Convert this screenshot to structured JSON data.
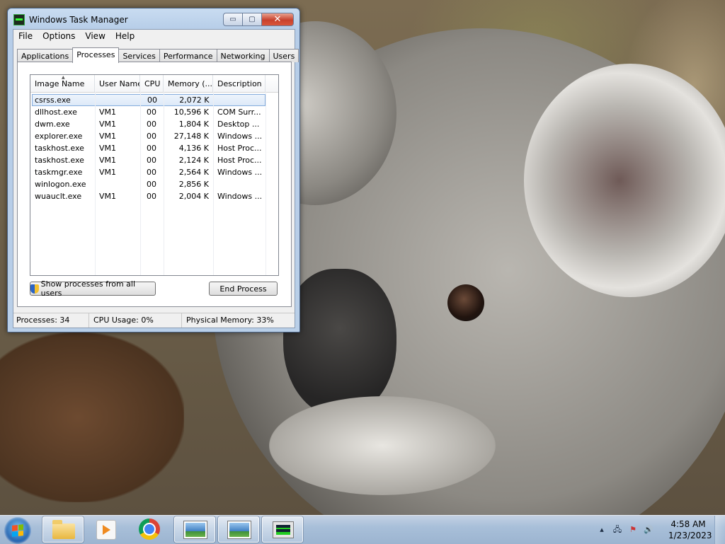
{
  "window": {
    "title": "Windows Task Manager",
    "buttons": {
      "minimize": "▭",
      "maximize": "▢",
      "close": "✕"
    }
  },
  "menu": [
    "File",
    "Options",
    "View",
    "Help"
  ],
  "tabs": [
    "Applications",
    "Processes",
    "Services",
    "Performance",
    "Networking",
    "Users"
  ],
  "active_tab": "Processes",
  "columns": [
    "Image Name",
    "User Name",
    "CPU",
    "Memory (...",
    "Description"
  ],
  "processes": [
    {
      "image": "csrss.exe",
      "user": "",
      "cpu": "00",
      "memory": "2,072 K",
      "desc": ""
    },
    {
      "image": "dllhost.exe",
      "user": "VM1",
      "cpu": "00",
      "memory": "10,596 K",
      "desc": "COM Surr..."
    },
    {
      "image": "dwm.exe",
      "user": "VM1",
      "cpu": "00",
      "memory": "1,804 K",
      "desc": "Desktop ..."
    },
    {
      "image": "explorer.exe",
      "user": "VM1",
      "cpu": "00",
      "memory": "27,148 K",
      "desc": "Windows ..."
    },
    {
      "image": "taskhost.exe",
      "user": "VM1",
      "cpu": "00",
      "memory": "4,136 K",
      "desc": "Host Proc..."
    },
    {
      "image": "taskhost.exe",
      "user": "VM1",
      "cpu": "00",
      "memory": "2,124 K",
      "desc": "Host Proc..."
    },
    {
      "image": "taskmgr.exe",
      "user": "VM1",
      "cpu": "00",
      "memory": "2,564 K",
      "desc": "Windows ..."
    },
    {
      "image": "winlogon.exe",
      "user": "",
      "cpu": "00",
      "memory": "2,856 K",
      "desc": ""
    },
    {
      "image": "wuauclt.exe",
      "user": "VM1",
      "cpu": "00",
      "memory": "2,004 K",
      "desc": "Windows ..."
    }
  ],
  "buttons": {
    "show_all": "Show processes from all users",
    "end_process": "End Process"
  },
  "status": {
    "processes": "Processes: 34",
    "cpu": "CPU Usage: 0%",
    "memory": "Physical Memory: 33%"
  },
  "taskbar": {
    "icons": [
      "windows-explorer-icon",
      "media-player-icon",
      "chrome-icon",
      "picture-viewer-icon",
      "picture-viewer-icon",
      "task-manager-icon"
    ],
    "time": "4:58 AM",
    "date": "1/23/2023"
  },
  "colors": {
    "accent": "#84acdd",
    "close": "#c8412d",
    "taskbar": "#a8bfd9"
  }
}
